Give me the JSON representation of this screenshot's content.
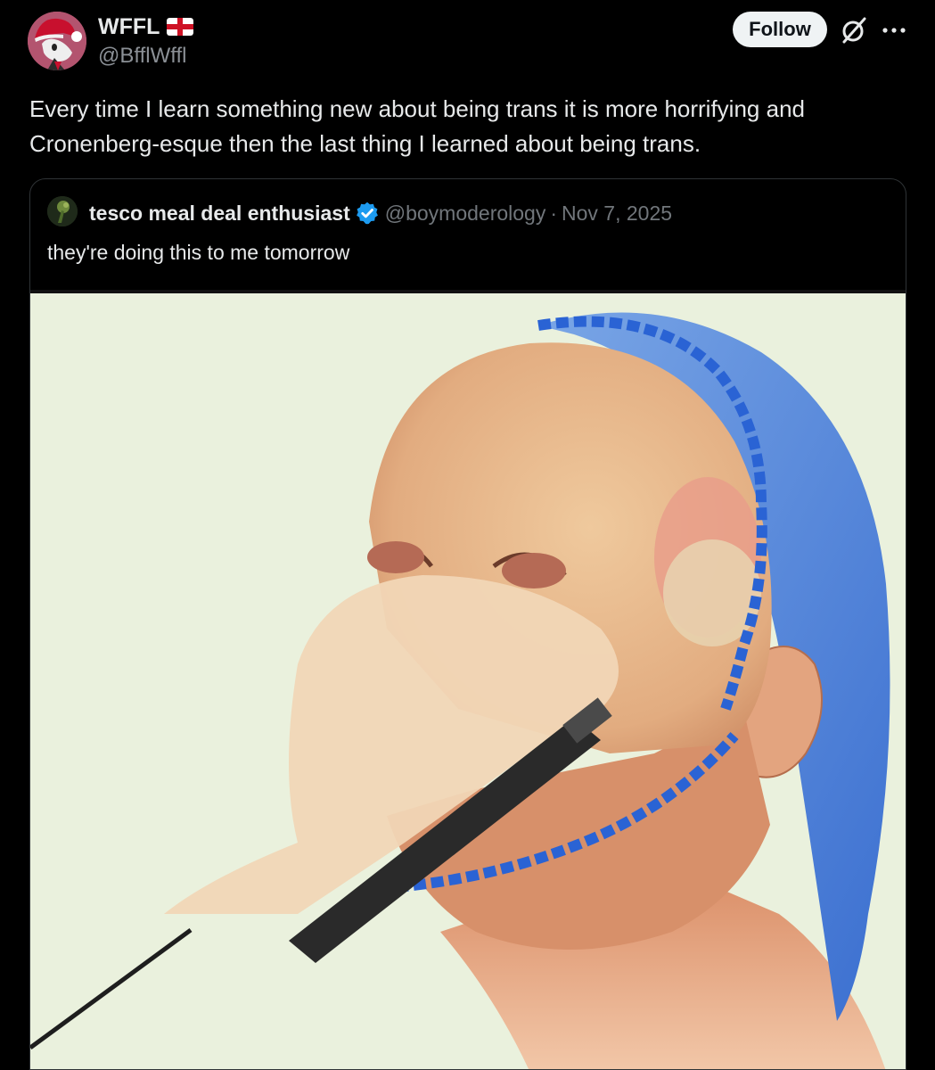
{
  "author": {
    "display_name": "WFFL",
    "handle": "@BfflWffl",
    "flag": "england-flag-icon"
  },
  "actions": {
    "follow_label": "Follow",
    "grok_icon": "grok-icon",
    "more_icon": "more-options-icon"
  },
  "post": {
    "text": "Every time I learn something new about being trans it is more horrifying and Cronenberg-esque then the last thing I learned about being trans."
  },
  "quote": {
    "display_name": "tesco meal deal enthusiast",
    "verified": true,
    "handle": "@boymoderology",
    "separator": "·",
    "date": "Nov 7, 2025",
    "text": "they're doing this to me tomorrow",
    "media": {
      "kind": "medical-illustration",
      "icon": "surgery-illustration"
    }
  },
  "colors": {
    "background": "#000000",
    "text_primary": "#e7e9ea",
    "text_secondary": "#71767b",
    "verified_blue": "#1d9bf0",
    "follow_bg": "#eff3f4",
    "border": "#2f3336"
  }
}
